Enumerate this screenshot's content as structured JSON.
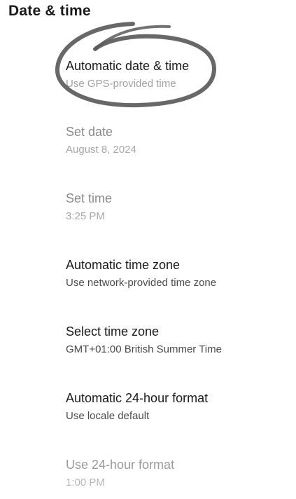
{
  "header": {
    "title": "Date & time"
  },
  "settings": {
    "automatic_date_time": {
      "title": "Automatic date & time",
      "summary": "Use GPS-provided time"
    },
    "set_date": {
      "title": "Set date",
      "summary": "August 8, 2024"
    },
    "set_time": {
      "title": "Set time",
      "summary": "3:25 PM"
    },
    "automatic_time_zone": {
      "title": "Automatic time zone",
      "summary": "Use network-provided time zone"
    },
    "select_time_zone": {
      "title": "Select time zone",
      "summary": "GMT+01:00 British Summer Time"
    },
    "automatic_24_hour_format": {
      "title": "Automatic 24-hour format",
      "summary": "Use locale default"
    },
    "use_24_hour_format": {
      "title": "Use 24-hour format",
      "summary": "1:00 PM"
    }
  },
  "annotation": {
    "type": "hand-drawn-circle",
    "color": "#5a5a5a",
    "target": "automatic_date_time"
  }
}
